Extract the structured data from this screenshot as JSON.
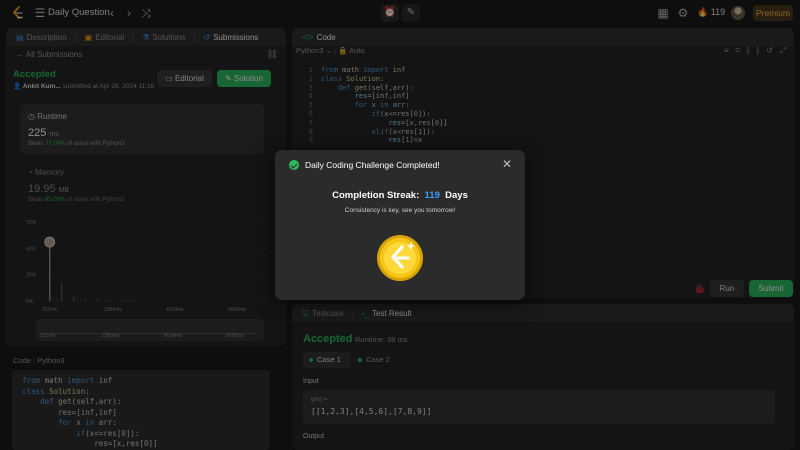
{
  "topbar": {
    "title": "Daily Question",
    "streak_count": "119",
    "premium_label": "Premium"
  },
  "left_panel": {
    "tabs": [
      {
        "label": "Description"
      },
      {
        "label": "Editorial"
      },
      {
        "label": "Solutions"
      },
      {
        "label": "Submissions"
      }
    ],
    "back_label": "All Submissions",
    "status": "Accepted",
    "submitter_name": "Ankit Kum...",
    "submitted_text": "submitted at Apr 26, 2024 11:16",
    "editorial_button": "Editorial",
    "solution_button": "Solution",
    "runtime": {
      "title": "Runtime",
      "value": "225",
      "unit": "ms",
      "beats_prefix": "Beats",
      "beats_value": "77.00%",
      "beats_suffix": "of users with Python3"
    },
    "memory": {
      "title": "Memory",
      "value": "19.95",
      "unit": "MB",
      "beats_prefix": "Beats",
      "beats_value": "85.00%",
      "beats_suffix": "of users with Python3"
    },
    "code_header": "Code",
    "code_lang": "Python3",
    "code_lines": [
      "from math import inf",
      "class Solution:",
      "    def get(self,arr):",
      "        res=[inf,inf]",
      "        for x in arr:",
      "            if(x<=res[0]):",
      "                res=[x,res[0]]"
    ]
  },
  "chart_data": {
    "type": "bar",
    "y_ticks": [
      "75%",
      "50%",
      "25%",
      "0%"
    ],
    "x_ticks": [
      "252ms",
      "2389ms",
      "4524ms",
      "6660ms"
    ],
    "slider_ticks": [
      "252ms",
      "2389ms",
      "4524ms",
      "6660ms"
    ],
    "values": [
      0.55,
      0.18,
      0.05,
      0.02,
      0.02,
      0.01,
      0.01,
      0.01
    ],
    "ylim": [
      0,
      0.75
    ]
  },
  "code_panel": {
    "title": "Code",
    "language": "Python3",
    "auto_label": "Auto",
    "line_numbers": [
      "1",
      "2",
      "3",
      "4",
      "5",
      "6",
      "7",
      "8",
      "9"
    ],
    "run_label": "Run",
    "submit_label": "Submit"
  },
  "test_panel": {
    "tabs": [
      {
        "label": "Testcase"
      },
      {
        "label": "Test Result"
      }
    ],
    "status": "Accepted",
    "runtime_text": "Runtime: 39 ms",
    "case1": "Case 1",
    "case2": "Case 2",
    "input_label": "Input",
    "input_name": "grid =",
    "input_value": "[[1,2,3],[4,5,6],[7,8,9]]",
    "output_label": "Output"
  },
  "modal": {
    "title": "Daily Coding Challenge Completed!",
    "streak_prefix": "Completion Streak:",
    "streak_number": "119",
    "streak_suffix": "Days",
    "message": "Consistency is key, see you tomorrow!"
  },
  "colors": {
    "accent_green": "#2cbb5d",
    "accent_blue": "#3b9eff",
    "streak_orange": "#ff8a1f",
    "coin_gold": "#f5c518"
  }
}
